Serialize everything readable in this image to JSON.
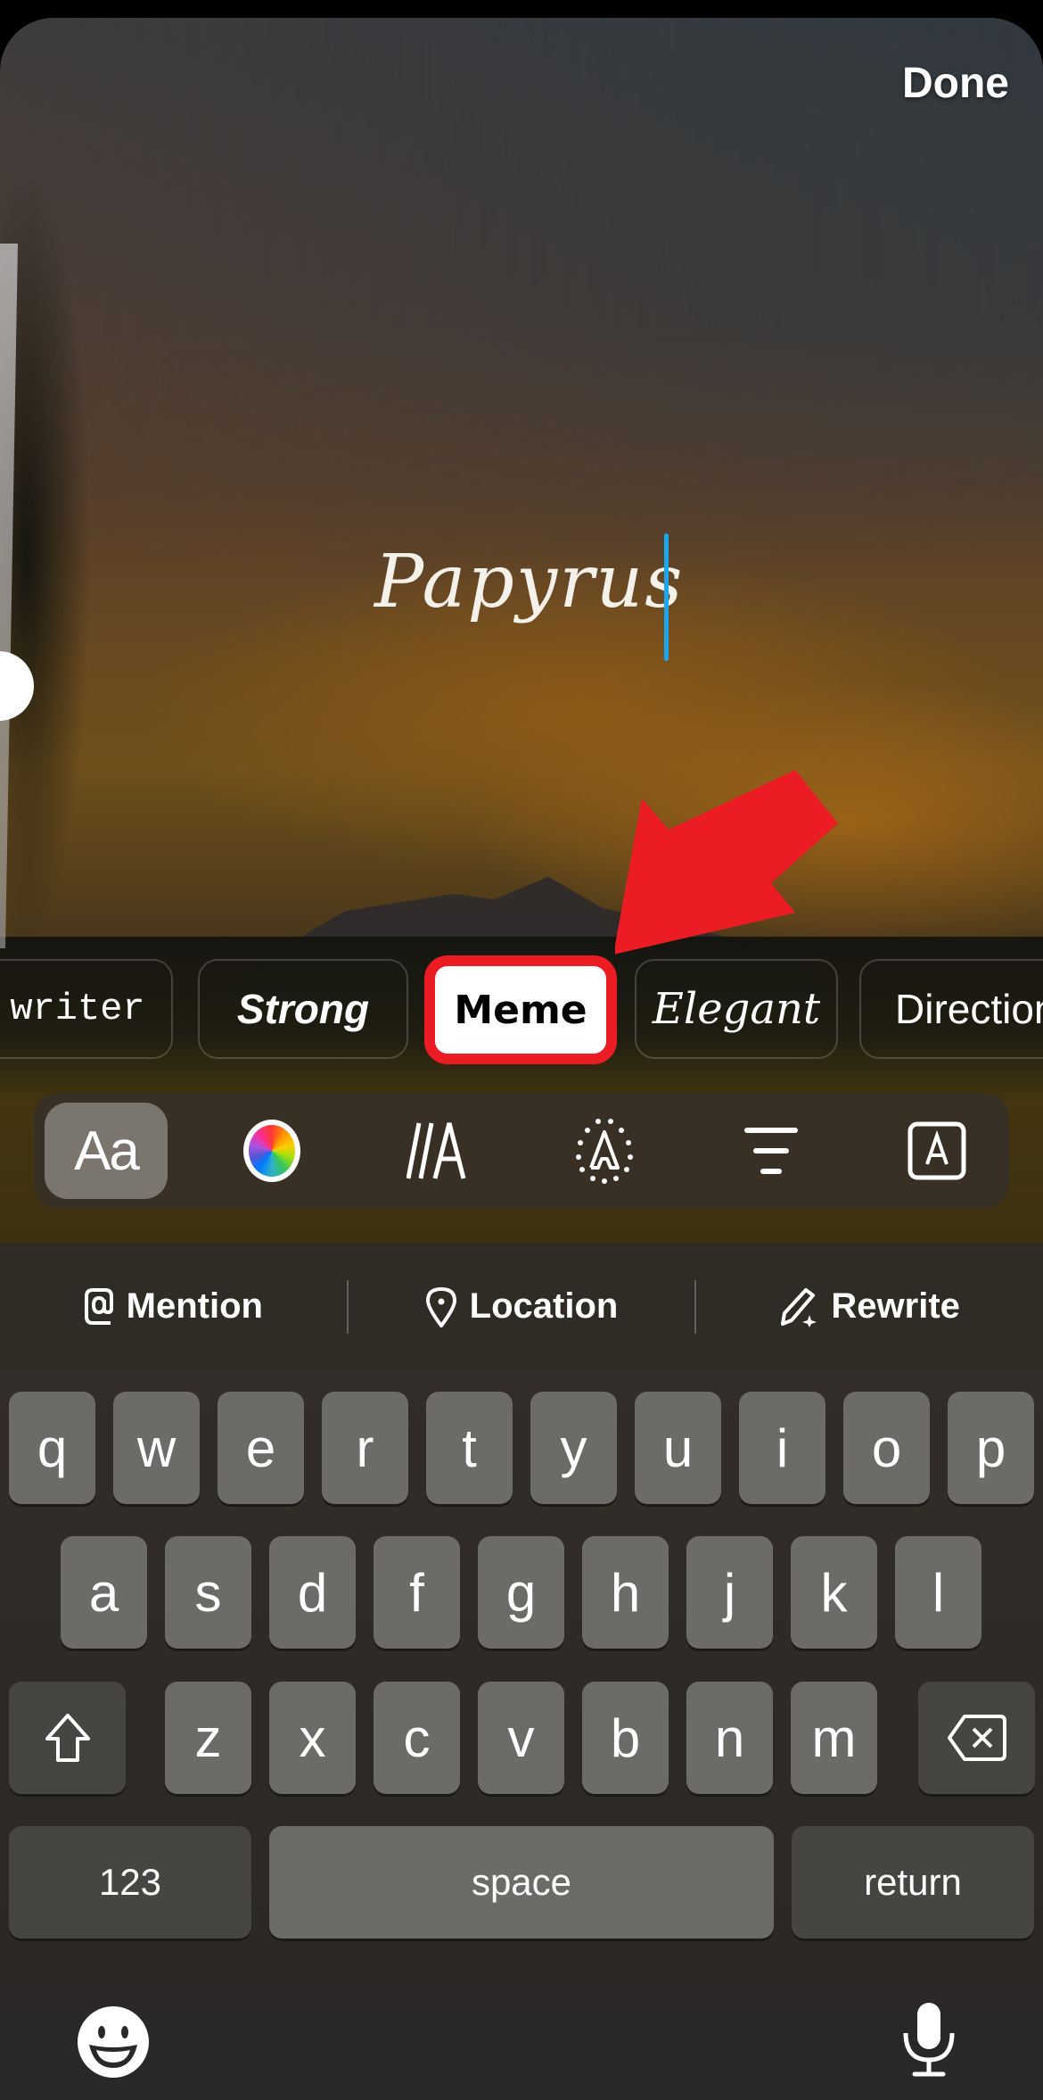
{
  "header": {
    "done_label": "Done"
  },
  "editor": {
    "text": "Papyrus",
    "caret_color": "#1aa7f0",
    "text_size_level": 0.42
  },
  "font_styles": {
    "selected": "Meme",
    "items": [
      {
        "label": "writer"
      },
      {
        "label": "Strong"
      },
      {
        "label": "Meme"
      },
      {
        "label": "Elegant"
      },
      {
        "label": "Direction"
      }
    ]
  },
  "annotation": {
    "arrow_color": "#ec1c24",
    "highlight_color": "#ec1c24",
    "target": "Meme"
  },
  "toolbar": {
    "items": [
      {
        "icon": "font-icon",
        "label": "Aa",
        "active": true
      },
      {
        "icon": "color-wheel-icon"
      },
      {
        "icon": "animation-icon",
        "label": "//A"
      },
      {
        "icon": "effects-icon",
        "label": "A"
      },
      {
        "icon": "align-center-icon"
      },
      {
        "icon": "background-box-icon",
        "label": "A"
      }
    ]
  },
  "actions": {
    "mention": "Mention",
    "location": "Location",
    "rewrite": "Rewrite"
  },
  "keyboard": {
    "row1": [
      "q",
      "w",
      "e",
      "r",
      "t",
      "y",
      "u",
      "i",
      "o",
      "p"
    ],
    "row2": [
      "a",
      "s",
      "d",
      "f",
      "g",
      "h",
      "j",
      "k",
      "l"
    ],
    "row3": [
      "z",
      "x",
      "c",
      "v",
      "b",
      "n",
      "m"
    ],
    "numbers_label": "123",
    "space_label": "space",
    "return_label": "return"
  }
}
